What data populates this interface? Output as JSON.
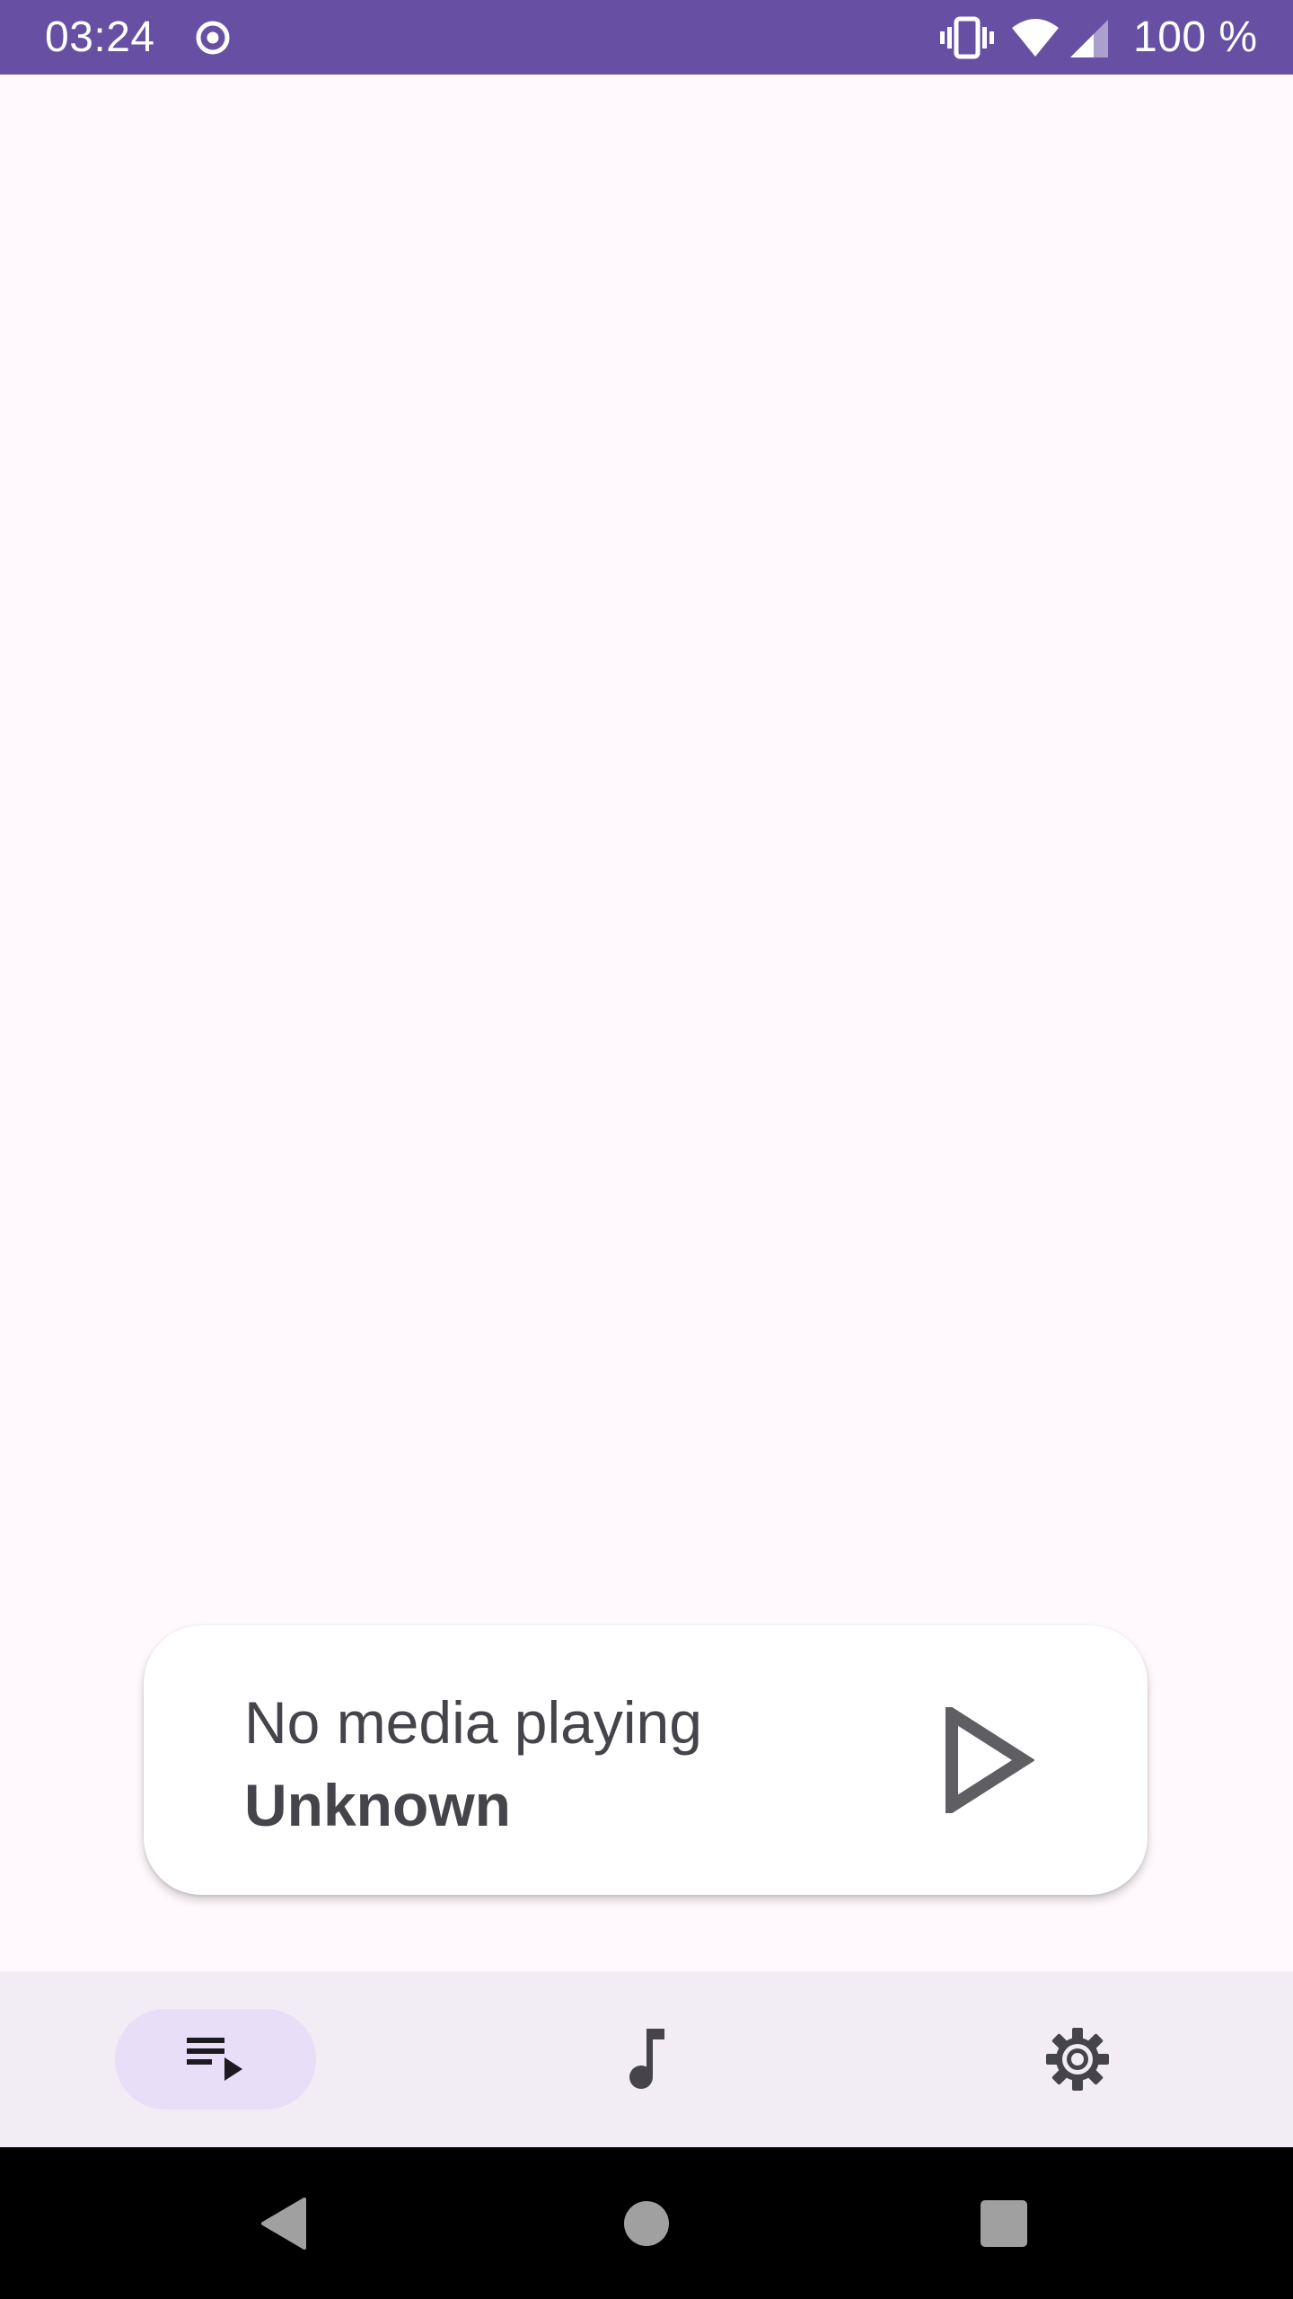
{
  "status_bar": {
    "time": "03:24",
    "battery": "100 %",
    "icons": [
      "record-icon",
      "vibrate-icon",
      "wifi-icon",
      "signal-icon"
    ],
    "background_color": "#6750A4"
  },
  "now_playing": {
    "title": "No media playing",
    "artist": "Unknown",
    "play_icon": "play-icon"
  },
  "bottom_nav": {
    "items": [
      {
        "icon": "queue-music-icon",
        "selected": true
      },
      {
        "icon": "music-note-icon",
        "selected": false
      },
      {
        "icon": "settings-icon",
        "selected": false
      }
    ],
    "selected_pill_color": "#E8DEF8"
  },
  "system_nav": {
    "buttons": [
      "back-icon",
      "home-icon",
      "recents-icon"
    ]
  },
  "colors": {
    "accent": "#6750A4",
    "background": "#FFF8FC",
    "nav_background": "#F2ECF4",
    "text": "#46444B"
  }
}
